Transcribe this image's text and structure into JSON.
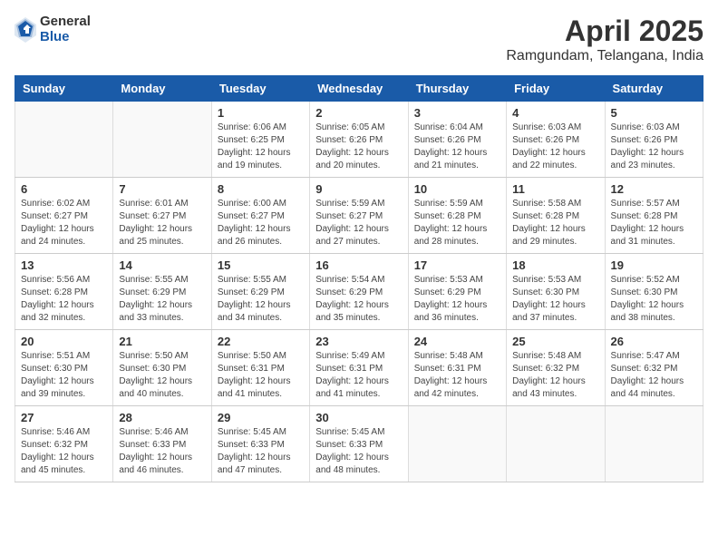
{
  "logo": {
    "general": "General",
    "blue": "Blue"
  },
  "title": {
    "month_year": "April 2025",
    "location": "Ramgundam, Telangana, India"
  },
  "weekdays": [
    "Sunday",
    "Monday",
    "Tuesday",
    "Wednesday",
    "Thursday",
    "Friday",
    "Saturday"
  ],
  "weeks": [
    [
      {
        "day": "",
        "sunrise": "",
        "sunset": "",
        "daylight": ""
      },
      {
        "day": "",
        "sunrise": "",
        "sunset": "",
        "daylight": ""
      },
      {
        "day": "1",
        "sunrise": "Sunrise: 6:06 AM",
        "sunset": "Sunset: 6:25 PM",
        "daylight": "Daylight: 12 hours and 19 minutes."
      },
      {
        "day": "2",
        "sunrise": "Sunrise: 6:05 AM",
        "sunset": "Sunset: 6:26 PM",
        "daylight": "Daylight: 12 hours and 20 minutes."
      },
      {
        "day": "3",
        "sunrise": "Sunrise: 6:04 AM",
        "sunset": "Sunset: 6:26 PM",
        "daylight": "Daylight: 12 hours and 21 minutes."
      },
      {
        "day": "4",
        "sunrise": "Sunrise: 6:03 AM",
        "sunset": "Sunset: 6:26 PM",
        "daylight": "Daylight: 12 hours and 22 minutes."
      },
      {
        "day": "5",
        "sunrise": "Sunrise: 6:03 AM",
        "sunset": "Sunset: 6:26 PM",
        "daylight": "Daylight: 12 hours and 23 minutes."
      }
    ],
    [
      {
        "day": "6",
        "sunrise": "Sunrise: 6:02 AM",
        "sunset": "Sunset: 6:27 PM",
        "daylight": "Daylight: 12 hours and 24 minutes."
      },
      {
        "day": "7",
        "sunrise": "Sunrise: 6:01 AM",
        "sunset": "Sunset: 6:27 PM",
        "daylight": "Daylight: 12 hours and 25 minutes."
      },
      {
        "day": "8",
        "sunrise": "Sunrise: 6:00 AM",
        "sunset": "Sunset: 6:27 PM",
        "daylight": "Daylight: 12 hours and 26 minutes."
      },
      {
        "day": "9",
        "sunrise": "Sunrise: 5:59 AM",
        "sunset": "Sunset: 6:27 PM",
        "daylight": "Daylight: 12 hours and 27 minutes."
      },
      {
        "day": "10",
        "sunrise": "Sunrise: 5:59 AM",
        "sunset": "Sunset: 6:28 PM",
        "daylight": "Daylight: 12 hours and 28 minutes."
      },
      {
        "day": "11",
        "sunrise": "Sunrise: 5:58 AM",
        "sunset": "Sunset: 6:28 PM",
        "daylight": "Daylight: 12 hours and 29 minutes."
      },
      {
        "day": "12",
        "sunrise": "Sunrise: 5:57 AM",
        "sunset": "Sunset: 6:28 PM",
        "daylight": "Daylight: 12 hours and 31 minutes."
      }
    ],
    [
      {
        "day": "13",
        "sunrise": "Sunrise: 5:56 AM",
        "sunset": "Sunset: 6:28 PM",
        "daylight": "Daylight: 12 hours and 32 minutes."
      },
      {
        "day": "14",
        "sunrise": "Sunrise: 5:55 AM",
        "sunset": "Sunset: 6:29 PM",
        "daylight": "Daylight: 12 hours and 33 minutes."
      },
      {
        "day": "15",
        "sunrise": "Sunrise: 5:55 AM",
        "sunset": "Sunset: 6:29 PM",
        "daylight": "Daylight: 12 hours and 34 minutes."
      },
      {
        "day": "16",
        "sunrise": "Sunrise: 5:54 AM",
        "sunset": "Sunset: 6:29 PM",
        "daylight": "Daylight: 12 hours and 35 minutes."
      },
      {
        "day": "17",
        "sunrise": "Sunrise: 5:53 AM",
        "sunset": "Sunset: 6:29 PM",
        "daylight": "Daylight: 12 hours and 36 minutes."
      },
      {
        "day": "18",
        "sunrise": "Sunrise: 5:53 AM",
        "sunset": "Sunset: 6:30 PM",
        "daylight": "Daylight: 12 hours and 37 minutes."
      },
      {
        "day": "19",
        "sunrise": "Sunrise: 5:52 AM",
        "sunset": "Sunset: 6:30 PM",
        "daylight": "Daylight: 12 hours and 38 minutes."
      }
    ],
    [
      {
        "day": "20",
        "sunrise": "Sunrise: 5:51 AM",
        "sunset": "Sunset: 6:30 PM",
        "daylight": "Daylight: 12 hours and 39 minutes."
      },
      {
        "day": "21",
        "sunrise": "Sunrise: 5:50 AM",
        "sunset": "Sunset: 6:30 PM",
        "daylight": "Daylight: 12 hours and 40 minutes."
      },
      {
        "day": "22",
        "sunrise": "Sunrise: 5:50 AM",
        "sunset": "Sunset: 6:31 PM",
        "daylight": "Daylight: 12 hours and 41 minutes."
      },
      {
        "day": "23",
        "sunrise": "Sunrise: 5:49 AM",
        "sunset": "Sunset: 6:31 PM",
        "daylight": "Daylight: 12 hours and 41 minutes."
      },
      {
        "day": "24",
        "sunrise": "Sunrise: 5:48 AM",
        "sunset": "Sunset: 6:31 PM",
        "daylight": "Daylight: 12 hours and 42 minutes."
      },
      {
        "day": "25",
        "sunrise": "Sunrise: 5:48 AM",
        "sunset": "Sunset: 6:32 PM",
        "daylight": "Daylight: 12 hours and 43 minutes."
      },
      {
        "day": "26",
        "sunrise": "Sunrise: 5:47 AM",
        "sunset": "Sunset: 6:32 PM",
        "daylight": "Daylight: 12 hours and 44 minutes."
      }
    ],
    [
      {
        "day": "27",
        "sunrise": "Sunrise: 5:46 AM",
        "sunset": "Sunset: 6:32 PM",
        "daylight": "Daylight: 12 hours and 45 minutes."
      },
      {
        "day": "28",
        "sunrise": "Sunrise: 5:46 AM",
        "sunset": "Sunset: 6:33 PM",
        "daylight": "Daylight: 12 hours and 46 minutes."
      },
      {
        "day": "29",
        "sunrise": "Sunrise: 5:45 AM",
        "sunset": "Sunset: 6:33 PM",
        "daylight": "Daylight: 12 hours and 47 minutes."
      },
      {
        "day": "30",
        "sunrise": "Sunrise: 5:45 AM",
        "sunset": "Sunset: 6:33 PM",
        "daylight": "Daylight: 12 hours and 48 minutes."
      },
      {
        "day": "",
        "sunrise": "",
        "sunset": "",
        "daylight": ""
      },
      {
        "day": "",
        "sunrise": "",
        "sunset": "",
        "daylight": ""
      },
      {
        "day": "",
        "sunrise": "",
        "sunset": "",
        "daylight": ""
      }
    ]
  ]
}
